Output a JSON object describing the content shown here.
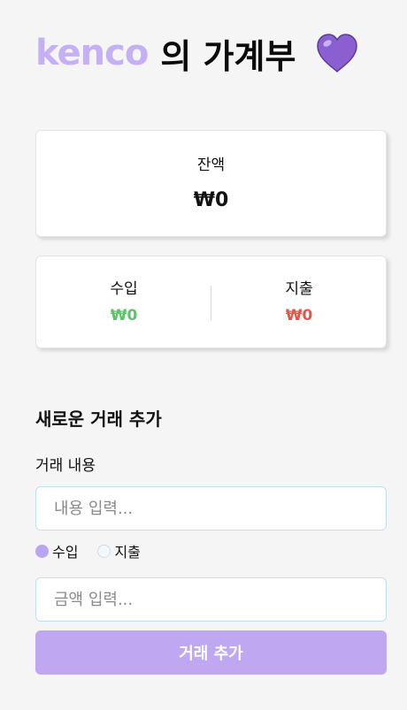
{
  "header": {
    "brand": "kenco",
    "title_rest": "의 가계부",
    "heart_icon": "purple-heart-icon",
    "brand_color": "#c5b0f5"
  },
  "balance": {
    "label": "잔액",
    "amount": "₩0"
  },
  "summary": {
    "income_label": "수입",
    "income_amount": "₩0",
    "expense_label": "지출",
    "expense_amount": "₩0",
    "income_color": "#5cc36b",
    "expense_color": "#e0594c"
  },
  "form": {
    "section_title": "새로운 거래 추가",
    "desc_label": "거래 내용",
    "desc_placeholder": "내용 입력...",
    "desc_value": "",
    "type_options": [
      {
        "label": "수입",
        "checked": true
      },
      {
        "label": "지출",
        "checked": false
      }
    ],
    "amount_placeholder": "금액 입력...",
    "amount_value": "",
    "submit_label": "거래 추가",
    "accent_color": "#bfa7f2"
  }
}
